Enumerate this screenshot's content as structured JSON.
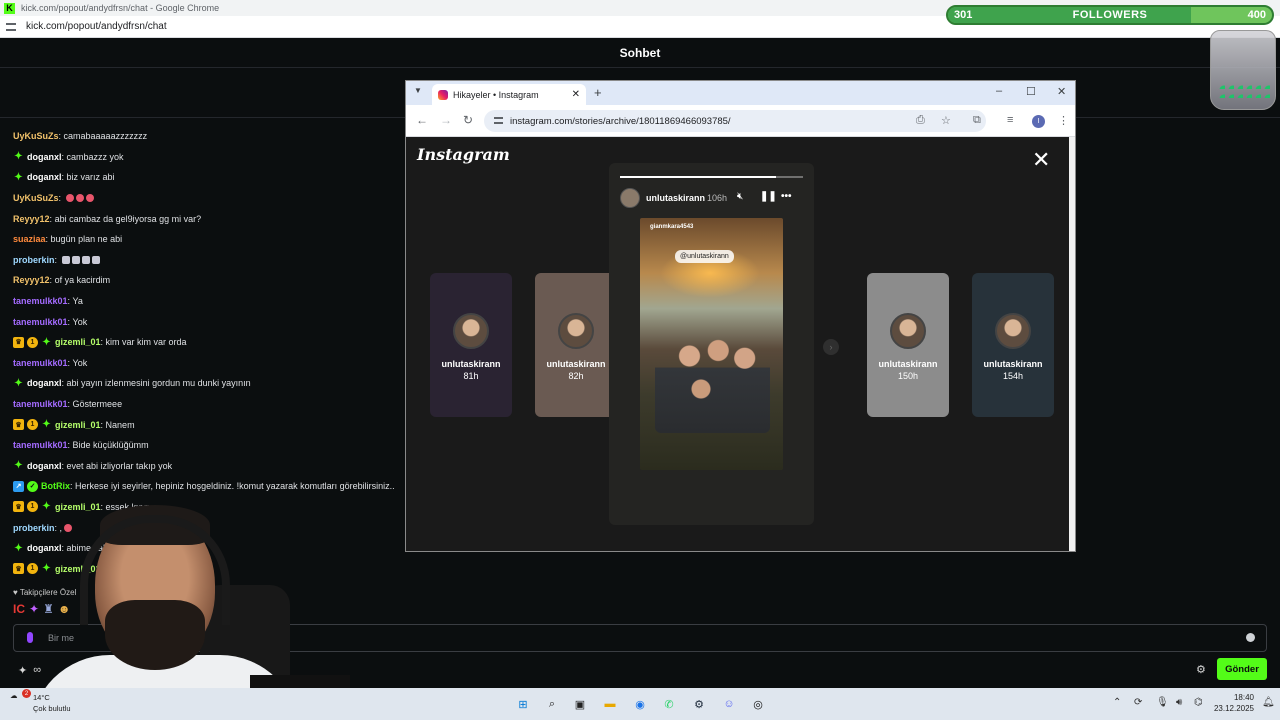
{
  "os_window": {
    "title": "kick.com/popout/andydfrsn/chat - Google Chrome",
    "url": "kick.com/popout/andydfrsn/chat"
  },
  "chat": {
    "header": "Sohbet",
    "messages": [
      {
        "user": "UyKuSuZs",
        "color": "#f2c26b",
        "badges": [],
        "text": "camabaaaaazzzzzzz"
      },
      {
        "user": "doganxl",
        "color": "#ffffff",
        "badges": [
          "gift"
        ],
        "text": "cambazzz yok"
      },
      {
        "user": "doganxl",
        "color": "#ffffff",
        "badges": [
          "gift"
        ],
        "text": "biz varız abi"
      },
      {
        "user": "UyKuSuZs",
        "color": "#f2c26b",
        "badges": [],
        "text": "",
        "emotes": 3
      },
      {
        "user": "Reyyy12",
        "color": "#f2c26b",
        "badges": [],
        "text": "abi cambaz da gel9iyorsa gg mi var?"
      },
      {
        "user": "suaziaa",
        "color": "#ff8a3d",
        "badges": [],
        "text": "bugün plan ne abi"
      },
      {
        "user": "proberkin",
        "color": "#9fd8ff",
        "badges": [],
        "text": "",
        "emotes": 4,
        "emote_style": "box"
      },
      {
        "user": "Reyyy12",
        "color": "#f2c26b",
        "badges": [],
        "text": "of ya kacirdim"
      },
      {
        "user": "tanemulkk01",
        "color": "#a46bff",
        "badges": [],
        "text": "Ya"
      },
      {
        "user": "tanemulkk01",
        "color": "#a46bff",
        "badges": [],
        "text": "Yok"
      },
      {
        "user": "gizemli_01",
        "color": "#b6ff6b",
        "badges": [
          "crown",
          "sub",
          "gift"
        ],
        "text": "kim var kim var orda"
      },
      {
        "user": "tanemulkk01",
        "color": "#a46bff",
        "badges": [],
        "text": "Yok"
      },
      {
        "user": "doganxl",
        "color": "#ffffff",
        "badges": [
          "gift"
        ],
        "text": "abi yayın izlenmesini gordun mu dunki yayının"
      },
      {
        "user": "tanemulkk01",
        "color": "#a46bff",
        "badges": [],
        "text": "Göstermeee"
      },
      {
        "user": "gizemli_01",
        "color": "#b6ff6b",
        "badges": [
          "crown",
          "sub",
          "gift"
        ],
        "text": "Nanem"
      },
      {
        "user": "tanemulkk01",
        "color": "#a46bff",
        "badges": [],
        "text": "Bide küçüklüğümm"
      },
      {
        "user": "doganxl",
        "color": "#ffffff",
        "badges": [
          "gift"
        ],
        "text": "evet abi izliyorlar takıp yok"
      },
      {
        "user": "BotRix",
        "color": "#53fc18",
        "badges": [
          "bot1",
          "bot2"
        ],
        "text": "Herkese iyi seyirler, hepiniz hoşgeldiniz. !komut yazarak komutları görebilirsiniz.."
      },
      {
        "user": "gizemli_01",
        "color": "#b6ff6b",
        "badges": [
          "crown",
          "sub",
          "gift"
        ],
        "text": "essek kuyr"
      },
      {
        "user": "proberkin",
        "color": "#9fd8ff",
        "badges": [],
        "text": ",",
        "emotes": 1
      },
      {
        "user": "doganxl",
        "color": "#ffffff",
        "badges": [
          "gift"
        ],
        "text": "abime yak siyo"
      },
      {
        "user": "gizemli_01",
        "color": "#b6ff6b",
        "badges": [
          "crown",
          "sub",
          "gift"
        ],
        "text": ""
      }
    ],
    "followers_only_label": "♥ Takipçilere Özel",
    "input_placeholder": "Bir me",
    "send_label": "Gönder"
  },
  "followers_goal": {
    "current": "301",
    "label": "FOLLOWERS",
    "target": "400",
    "progress": 0.75,
    "fill_color": "#3fa34d"
  },
  "instagram_window": {
    "tab_title": "Hikayeler • Instagram",
    "url": "instagram.com/stories/archive/18011869466093785/",
    "profile_initial": "I",
    "logo": "Instagram",
    "story": {
      "username": "unlutaskirann",
      "time": "106h",
      "photo_tag": "@unlutaskirann",
      "photo_handle": "gianmkara4543",
      "progress": 0.85
    },
    "thumbnails": [
      {
        "username": "unlutaskirann",
        "time": "81h",
        "bg": "#2a2332"
      },
      {
        "username": "unlutaskirann",
        "time": "82h",
        "bg": "#6a5a52"
      },
      {
        "username": "unlutaskirann",
        "time": "150h",
        "bg": "#8c8c8c"
      },
      {
        "username": "unlutaskirann",
        "time": "154h",
        "bg": "#27323a"
      }
    ]
  },
  "taskbar": {
    "weather_temp": "14°C",
    "weather_desc": "Çok bulutlu",
    "weather_badge": "2",
    "time": "18:40",
    "date": "23.12.2025"
  }
}
